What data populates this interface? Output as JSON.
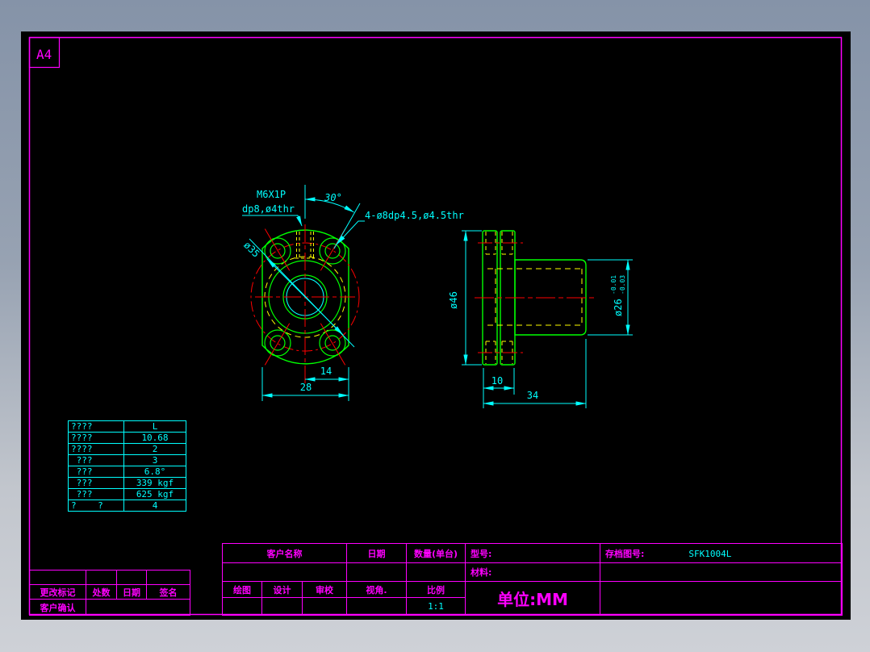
{
  "sheet": {
    "size": "A4"
  },
  "front_view": {
    "thread_callout_line1": "M6X1P",
    "thread_callout_line2": "dp8,ø4thr",
    "angle_dim": "30°",
    "hole_callout": "4-ø8dp4.5,ø4.5thr",
    "bolt_circle_dim": "ø35",
    "dim_half_width": "14",
    "dim_width": "28"
  },
  "side_view": {
    "dim_flange_dia": "ø46",
    "dim_pilot_dia": "ø26",
    "tol_upper": "-0.01",
    "tol_lower": "-0.03",
    "dim_flange_thk": "10",
    "dim_total_len": "34"
  },
  "param_table": {
    "rows": [
      {
        "label": "????",
        "value": "L"
      },
      {
        "label": "????",
        "value": "10.68"
      },
      {
        "label": "????",
        "value": "2"
      },
      {
        "label": " ???",
        "value": "3"
      },
      {
        "label": " ???",
        "value": "6.8°"
      },
      {
        "label": " ???",
        "value": "339 kgf"
      },
      {
        "label": " ???",
        "value": "625 kgf"
      },
      {
        "label": "?    ?",
        "value": "4"
      }
    ]
  },
  "title_block": {
    "customer_name": "客户名称",
    "date": "日期",
    "quantity": "数量(单台)",
    "model": "型号:",
    "archive_no": "存档图号:",
    "archive_value": "SFK1004L",
    "material": "材料:",
    "draw": "绘图",
    "design": "设计",
    "check": "审校",
    "view_angle": "视角.",
    "scale": "比例",
    "scale_value": "1:1",
    "unit": "单位:MM"
  },
  "revision_block": {
    "change_mark": "更改标记",
    "places": "处数",
    "date": "日期",
    "signature": "签名",
    "customer_confirm": "客户确认"
  },
  "colors": {
    "outline_green": "#00ff00",
    "centerline_red": "#ff0000",
    "hidden_yellow": "#ffff00",
    "dimension_cyan": "#00ffff",
    "frame_magenta": "#ff00ff"
  }
}
